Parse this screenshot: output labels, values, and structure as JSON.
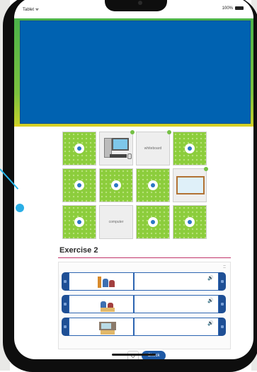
{
  "status_bar": {
    "carrier": "Tablet ᯤ",
    "battery": "100%"
  },
  "memory_game": {
    "cards": [
      {
        "kind": "hidden"
      },
      {
        "kind": "image",
        "subject": "computer"
      },
      {
        "kind": "word",
        "text": "whiteboard"
      },
      {
        "kind": "hidden"
      },
      {
        "kind": "hidden"
      },
      {
        "kind": "hidden"
      },
      {
        "kind": "hidden"
      },
      {
        "kind": "image",
        "subject": "whiteboard"
      },
      {
        "kind": "hidden"
      },
      {
        "kind": "word",
        "text": "computer"
      },
      {
        "kind": "hidden"
      },
      {
        "kind": "hidden"
      }
    ]
  },
  "exercise": {
    "title": "Exercise 2",
    "expand_icon": "::",
    "rows": [
      {
        "audio_icon": "speaker-icon"
      },
      {
        "audio_icon": "speaker-icon"
      },
      {
        "audio_icon": "speaker-icon"
      }
    ],
    "reset_symbol": "↺",
    "check_label": "Check"
  },
  "colors": {
    "accent": "#1f5aa6",
    "game_green": "#8ccd3c",
    "video_blue": "#0062b1",
    "rule_pink": "#c0336a"
  }
}
